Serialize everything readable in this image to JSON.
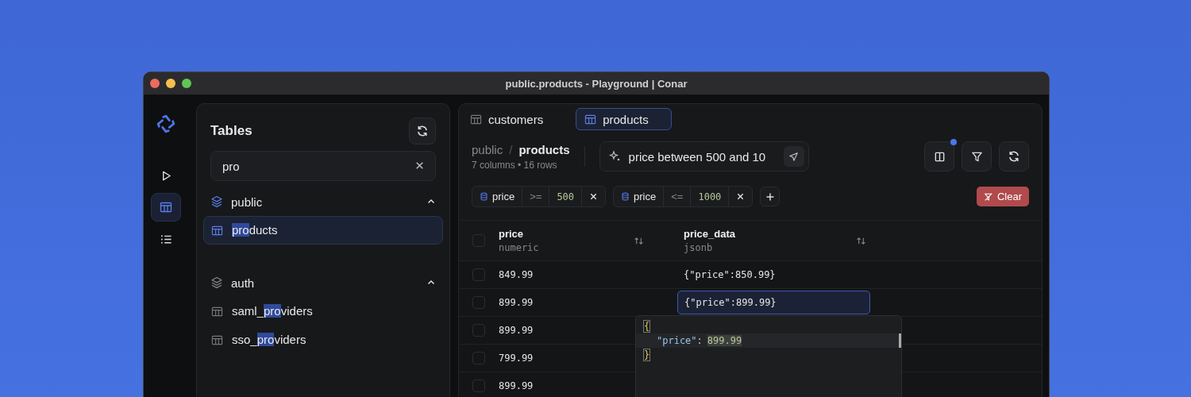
{
  "window": {
    "title": "public.products - Playground | Conar"
  },
  "rail": [
    {
      "kind": "run",
      "selected": false
    },
    {
      "kind": "tables",
      "selected": true
    },
    {
      "kind": "list",
      "selected": false
    }
  ],
  "tables_panel": {
    "title": "Tables",
    "search": {
      "value": "pro"
    },
    "groups": [
      {
        "name": "public",
        "expanded": true,
        "active": true,
        "items": [
          {
            "match": "pro",
            "suffix": "ducts",
            "selected": true
          }
        ]
      },
      {
        "name": "auth",
        "expanded": true,
        "active": false,
        "items": [
          {
            "prefix": "saml_",
            "match": "pro",
            "suffix": "viders",
            "selected": false
          },
          {
            "prefix": "sso_",
            "match": "pro",
            "suffix": "viders",
            "selected": false
          }
        ]
      }
    ]
  },
  "tabs": [
    {
      "label": "customers",
      "selected": false
    },
    {
      "label": "products",
      "selected": true
    }
  ],
  "breadcrumb": {
    "schema": "public",
    "separator": "/",
    "table": "products",
    "meta": "7 columns • 16 rows"
  },
  "query": {
    "value": "price between 500 and 10"
  },
  "toolbar": [
    {
      "kind": "columns",
      "indicator": true
    },
    {
      "kind": "filter",
      "indicator": false
    },
    {
      "kind": "refresh",
      "indicator": false
    }
  ],
  "filters": [
    {
      "column": "price",
      "operator": ">=",
      "value": "500"
    },
    {
      "column": "price",
      "operator": "<=",
      "value": "1000"
    }
  ],
  "clear_button": "Clear",
  "table": {
    "columns": [
      {
        "name": "price",
        "type": "numeric"
      },
      {
        "name": "price_data",
        "type": "jsonb"
      }
    ],
    "select_all": {
      "checked": false
    },
    "rows": [
      {
        "checked": false,
        "cells": [
          {
            "text": "849.99",
            "selected": false
          },
          {
            "text": "{\"price\":850.99}",
            "selected": false
          }
        ]
      },
      {
        "checked": false,
        "cells": [
          {
            "text": "899.99",
            "selected": false
          },
          {
            "text": "{\"price\":899.99}",
            "selected": true
          }
        ]
      },
      {
        "checked": false,
        "cells": [
          {
            "text": "899.99",
            "selected": false
          }
        ]
      },
      {
        "checked": false,
        "cells": [
          {
            "text": "799.99",
            "selected": false
          }
        ]
      },
      {
        "checked": false,
        "cells": [
          {
            "text": "899.99",
            "selected": false
          }
        ]
      }
    ]
  },
  "editor": {
    "lines": [
      {
        "kind": "brace",
        "text": "{"
      },
      {
        "kind": "pair",
        "key": "\"price\"",
        "separator": ":",
        "value": "899.99"
      },
      {
        "kind": "brace",
        "text": "}"
      }
    ]
  }
}
